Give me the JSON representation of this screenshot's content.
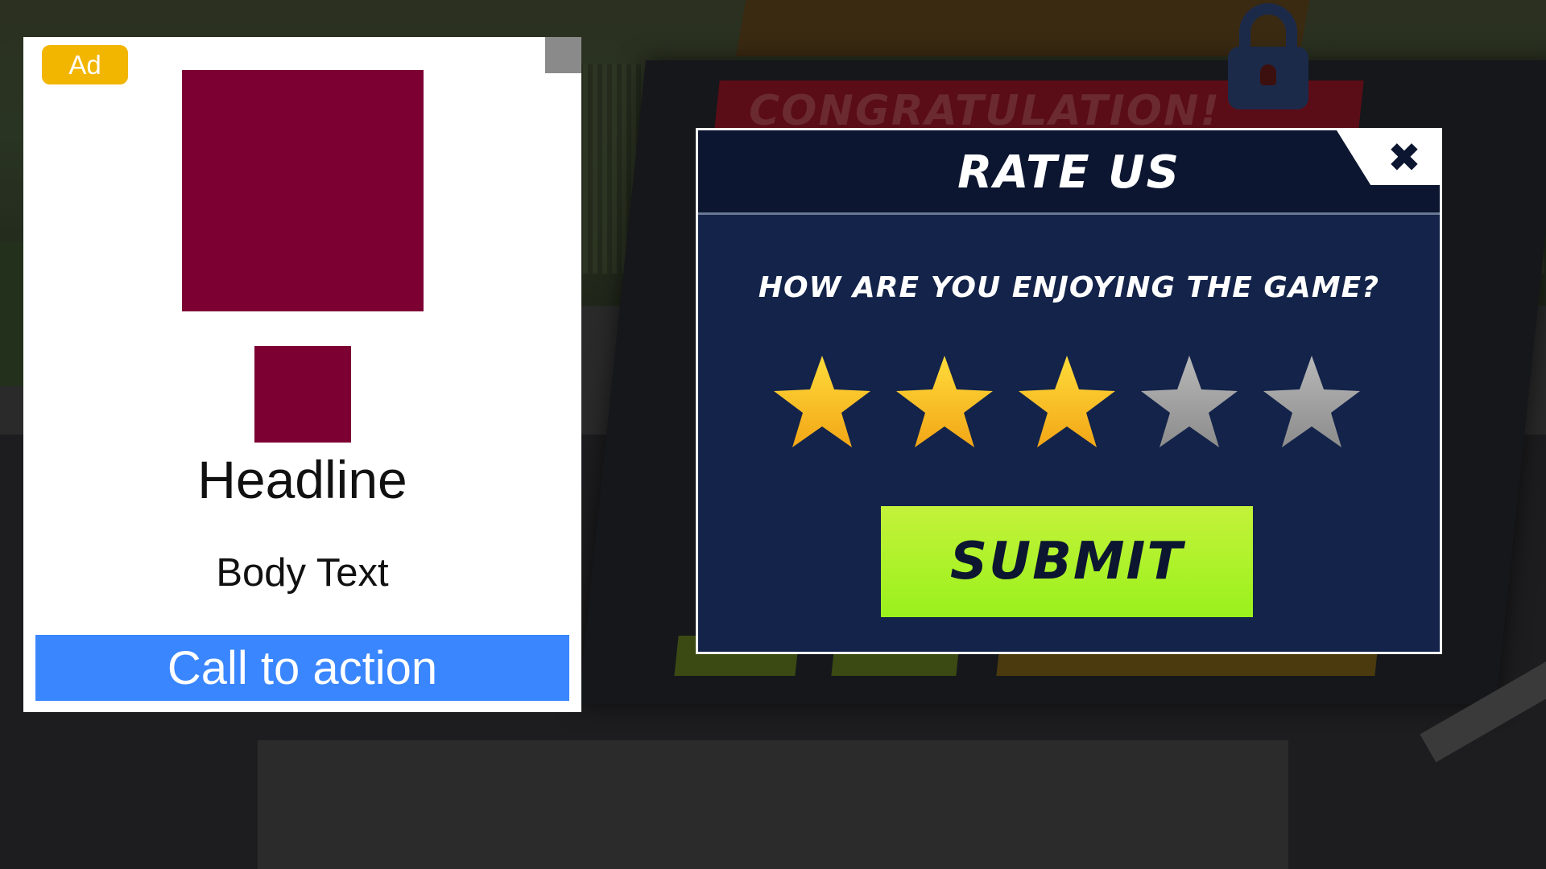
{
  "background": {
    "banner_text": "CONGRATULATION!"
  },
  "ad": {
    "badge": "Ad",
    "headline": "Headline",
    "body": "Body Text",
    "cta": "Call to action",
    "media_color": "#7d0033",
    "cta_color": "#3a86ff"
  },
  "rate_dialog": {
    "title": "RATE US",
    "close_icon": "close-icon",
    "question": "HOW ARE YOU ENJOYING THE GAME?",
    "rating": {
      "value": 3,
      "max": 5
    },
    "submit_label": "SUBMIT",
    "colors": {
      "star_filled": "#f7c21a",
      "star_empty": "#a6a6a6",
      "submit": "#9af11c",
      "panel": "#13234a"
    }
  }
}
